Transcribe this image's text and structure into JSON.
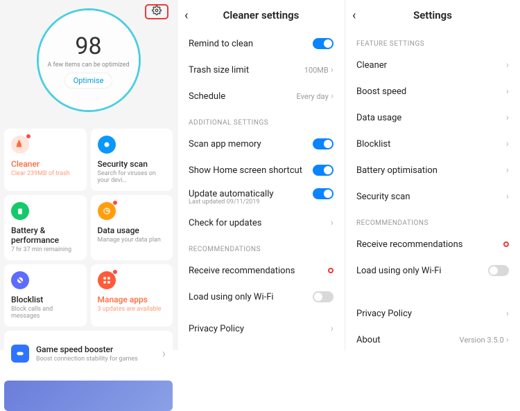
{
  "p1": {
    "score": "98",
    "subtitle": "A few items can be optimized",
    "optimise": "Optimise",
    "cards": {
      "cleaner": {
        "title": "Cleaner",
        "sub": "Clear 239MB of trash"
      },
      "security": {
        "title": "Security scan",
        "sub": "Search for viruses on your devi…"
      },
      "battery": {
        "title": "Battery & performance",
        "sub": "7 hr 37 min  remaining"
      },
      "data": {
        "title": "Data usage",
        "sub": "Manage your data plan"
      },
      "blocklist": {
        "title": "Blocklist",
        "sub": "Block calls and messages"
      },
      "manage": {
        "title": "Manage apps",
        "sub": "3 updates are available"
      },
      "gamespeed": {
        "title": "Game speed booster",
        "sub": "Boost connection stability for games"
      }
    }
  },
  "p2": {
    "title": "Cleaner settings",
    "remind": "Remind to clean",
    "trash": "Trash size limit",
    "trash_val": "100MB",
    "schedule": "Schedule",
    "schedule_val": "Every day",
    "sec_additional": "ADDITIONAL SETTINGS",
    "scan_mem": "Scan app memory",
    "home_shortcut": "Show Home screen shortcut",
    "update_auto": "Update automatically",
    "update_auto_sub": "Last updated 09/11/2019",
    "check_updates": "Check for updates",
    "sec_reco": "RECOMMENDATIONS",
    "recv_reco": "Receive recommendations",
    "wifi_only": "Load using only Wi-Fi",
    "privacy": "Privacy Policy"
  },
  "p3": {
    "title": "Settings",
    "sec_feature": "FEATURE SETTINGS",
    "cleaner": "Cleaner",
    "boost": "Boost speed",
    "data": "Data usage",
    "blocklist": "Blocklist",
    "battery": "Battery optimisation",
    "security": "Security scan",
    "sec_reco": "RECOMMENDATIONS",
    "recv_reco": "Receive recommendations",
    "wifi_only": "Load using only Wi-Fi",
    "privacy": "Privacy Policy",
    "about": "About",
    "about_val": "Version 3.5.0"
  }
}
